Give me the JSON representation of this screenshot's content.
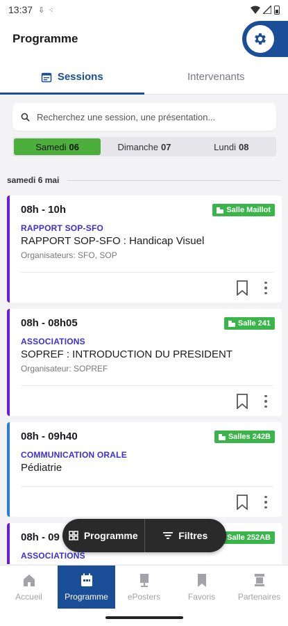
{
  "status_bar": {
    "time": "13:37"
  },
  "app_bar": {
    "title": "Programme",
    "settings_icon": "gear-icon"
  },
  "tabs": [
    {
      "label": "Sessions",
      "icon": "calendar-icon",
      "active": true
    },
    {
      "label": "Intervenants",
      "active": false
    }
  ],
  "search": {
    "placeholder": "Recherchez une session, une présentation..."
  },
  "days": [
    {
      "name": "Samedi",
      "num": "06",
      "active": true
    },
    {
      "name": "Dimanche",
      "num": "07",
      "active": false
    },
    {
      "name": "Lundi",
      "num": "08",
      "active": false
    }
  ],
  "date_header": "samedi 6 mai",
  "sessions": [
    {
      "time": "08h - 10h",
      "room": "Salle Maillot",
      "category": "RAPPORT SOP-SFO",
      "title": "RAPPORT SOP-SFO : Handicap Visuel",
      "organizers": "Organisateurs: SFO, SOP",
      "accent": "#6a1bd6"
    },
    {
      "time": "08h - 08h05",
      "room": "Salle 241",
      "category": "ASSOCIATIONS",
      "title": "SOPREF : INTRODUCTION DU PRESIDENT",
      "organizers": "Organisateur: SOPREF",
      "accent": "#6a1bd6"
    },
    {
      "time": "08h - 09h40",
      "room": "Salles 242B",
      "category": "COMMUNICATION ORALE",
      "title": "Pédiatrie",
      "organizers": "",
      "accent": "#2a7be0"
    },
    {
      "time": "08h - 09",
      "room": "Salle 252AB",
      "category": "ASSOCIATIONS",
      "title": "",
      "organizers": "",
      "accent": "#6a1bd6"
    }
  ],
  "fab": {
    "programme_label": "Programme",
    "filters_label": "Filtres"
  },
  "bottom_nav": [
    {
      "label": "Accueil",
      "icon": "home-icon",
      "active": false
    },
    {
      "label": "Programme",
      "icon": "calendar-icon",
      "active": true
    },
    {
      "label": "ePosters",
      "icon": "poster-icon",
      "active": false
    },
    {
      "label": "Favoris",
      "icon": "bookmark-icon",
      "active": false
    },
    {
      "label": "Partenaires",
      "icon": "partners-icon",
      "active": false
    }
  ],
  "colors": {
    "primary": "#1a4e96",
    "active_day": "#4caf3c",
    "room_badge": "#39b54a",
    "category_text": "#3a2fd6"
  }
}
